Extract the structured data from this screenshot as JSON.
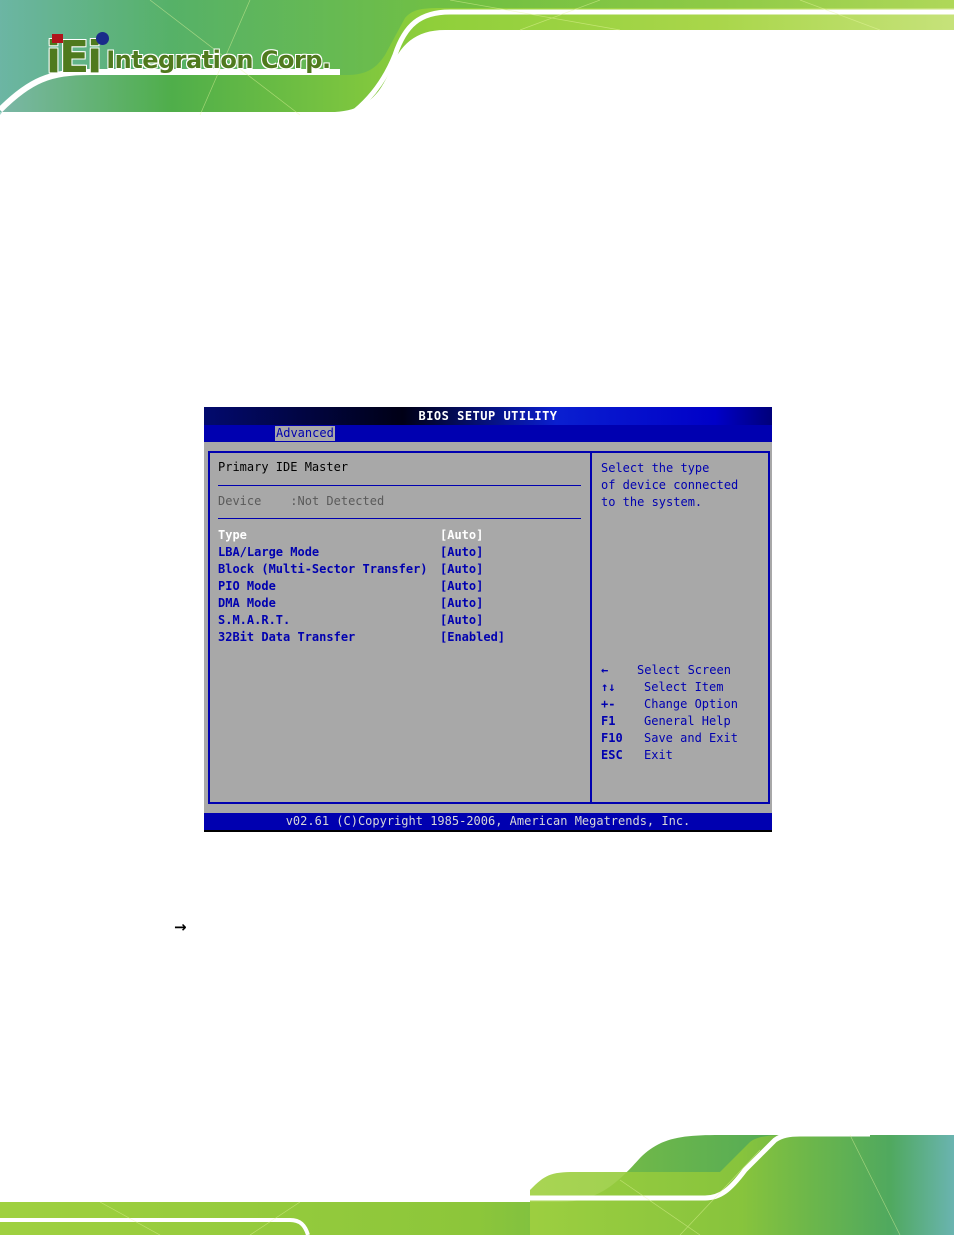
{
  "logo": {
    "mark": "iEi",
    "text": "Integration Corp."
  },
  "bios": {
    "title": "BIOS SETUP UTILITY",
    "active_tab": "Advanced",
    "section_title": "Primary IDE Master",
    "device": {
      "label": "Device",
      "value": ":Not Detected"
    },
    "settings": [
      {
        "label": "Type",
        "value": "[Auto]",
        "selected": true
      },
      {
        "label": "LBA/Large Mode",
        "value": "[Auto]",
        "selected": false
      },
      {
        "label": "Block (Multi-Sector Transfer)",
        "value": "[Auto]",
        "selected": false
      },
      {
        "label": "PIO Mode",
        "value": "[Auto]",
        "selected": false
      },
      {
        "label": "DMA Mode",
        "value": "[Auto]",
        "selected": false
      },
      {
        "label": "S.M.A.R.T.",
        "value": "[Auto]",
        "selected": false
      },
      {
        "label": "32Bit Data Transfer",
        "value": "[Enabled]",
        "selected": false
      }
    ],
    "help_text": "Select the type\nof device connected\nto the system.",
    "keys": [
      {
        "key": "←",
        "desc": "Select Screen"
      },
      {
        "key": "↑↓",
        "desc": "Select Item"
      },
      {
        "key": "+-",
        "desc": "Change Option"
      },
      {
        "key": "F1",
        "desc": "General Help"
      },
      {
        "key": "F10",
        "desc": "Save and Exit"
      },
      {
        "key": "ESC",
        "desc": "Exit"
      }
    ],
    "status_bar": "v02.61 (C)Copyright 1985-2006, American Megatrends, Inc.",
    "colors": {
      "background": "#a8a8a8",
      "accent_blue": "#0000b0",
      "selected_text": "#ffffff",
      "disabled_text": "#5a5a5a"
    }
  },
  "doc": {
    "bullet_icon": "→"
  }
}
